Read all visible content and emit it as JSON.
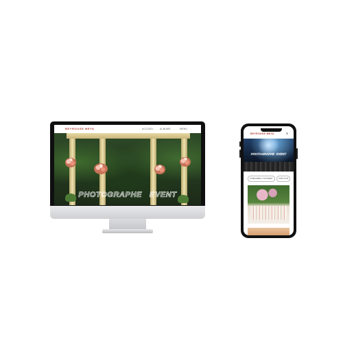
{
  "desktop_site": {
    "logo": "BEYROUSE MEYA",
    "nav_links": [
      "ACCUEIL",
      "ALBUMS",
      "MENU"
    ],
    "hero_title": "PHOTOGRAPHE   EVENT"
  },
  "mobile_site": {
    "logo": "BEYROUSE MEYA",
    "menu_icon": "≡",
    "hero_title": "PHOTOGRAPHE  EVENT",
    "filters": [
      "CATÉGORIES ▾ TOUSSERT",
      "VOIR TOUS"
    ]
  },
  "colors": {
    "brand": "#b0352f",
    "device_frame": "#0f0f10",
    "stand": "#d0d1d4"
  },
  "icons": {
    "menu": "hamburger-menu-icon"
  }
}
